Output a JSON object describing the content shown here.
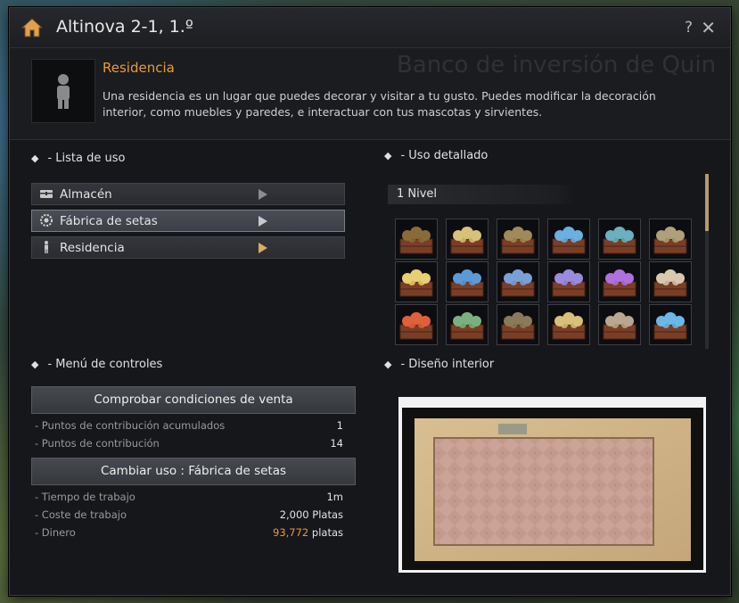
{
  "window": {
    "title": "Altinova 2-1, 1.º",
    "help_label": "?",
    "close_label": "✕"
  },
  "header": {
    "heading": "Residencia",
    "description": "Una residencia es un lugar que puedes decorar y visitar a tu gusto. Puedes modificar la decoración interior, como muebles y paredes, e interactuar con tus mascotas y sirvientes.",
    "background_text": "Banco de inversión de Quin"
  },
  "usage_list": {
    "label": "- Lista de uso",
    "items": [
      {
        "label": "Almacén",
        "icon": "chest-icon",
        "active": false
      },
      {
        "label": "Fábrica de setas",
        "icon": "gear-icon",
        "active": true
      },
      {
        "label": "Residencia",
        "icon": "person-icon",
        "active": false
      }
    ]
  },
  "detail": {
    "label": "- Uso detallado",
    "level": "1 Nivel",
    "mushroom_colors": [
      [
        "#8b6a3a",
        "#d8c27a",
        "#a08a5a",
        "#6ab0e0",
        "#6ab0c0",
        "#b0a07a"
      ],
      [
        "#e8d070",
        "#5a9ad8",
        "#7aa0d8",
        "#9a8ae0",
        "#b070e0",
        "#d8c8b0"
      ],
      [
        "#e0603a",
        "#7ab080",
        "#8a7a5a",
        "#d8c07a",
        "#b8a890",
        "#6ab8e8"
      ]
    ]
  },
  "controls": {
    "label": "- Menú de controles",
    "check_button": "Comprobar condiciones de venta",
    "contribution_acc_label": "- Puntos de contribución acumulados",
    "contribution_acc_value": "1",
    "contribution_label": "- Puntos de contribución",
    "contribution_value": "14",
    "change_button": "Cambiar uso : Fábrica de setas",
    "work_time_label": "- Tiempo de trabajo",
    "work_time_value": "1m",
    "work_cost_label": "- Coste de trabajo",
    "work_cost_value": "2,000 Platas",
    "money_label": "- Dinero",
    "money_amount": "93,772",
    "money_unit": " platas"
  },
  "interior": {
    "label": "- Diseño interior"
  },
  "colors": {
    "accent": "#e89a3c",
    "window_bg": "#15171b"
  }
}
